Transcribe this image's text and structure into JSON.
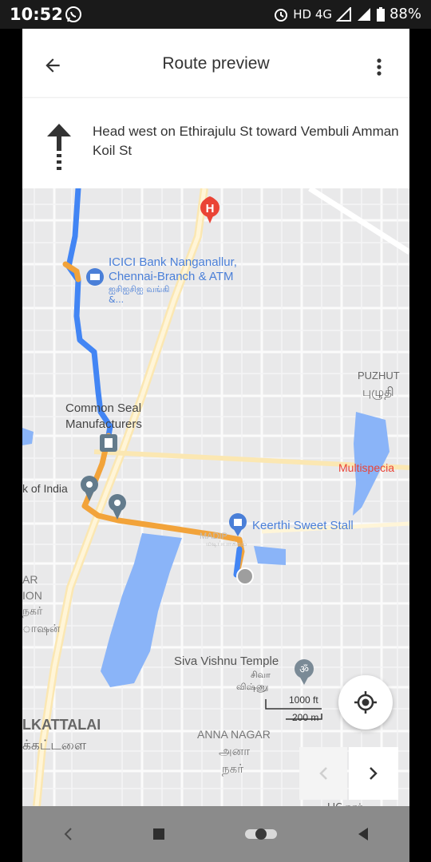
{
  "status_bar": {
    "time": "10:52",
    "network": "HD 4G",
    "battery": "88%"
  },
  "header": {
    "title": "Route preview"
  },
  "direction": {
    "text": "Head west on Ethirajulu St toward Vembuli Amman Koil St"
  },
  "map": {
    "labels": {
      "icici": "ICICI Bank Nanganallur, Chennai-Branch & ATM",
      "icici_tamil": "ஐசிஐசிஐ வங்கி &...",
      "common_seal": "Common Seal Manufacturers",
      "bank_of_india": "k of India",
      "puzhu": "PUZHUT",
      "puzhu_tamil": "புழுதி",
      "multispecial": "Multispecia",
      "keerthi": "Keerthi Sweet Stall",
      "madipakkam": "MADIP",
      "madipakkam_tamil": "மடிப்பாக்கம்",
      "ar": "AR",
      "ion": "ION",
      "nagar_tamil": "நகர்",
      "station_tamil": "ாஷன்",
      "siva_vishnu": "Siva Vishnu Temple",
      "siva_tamil": "சிவா",
      "vishnu_tamil": "விஷ்ணு",
      "kattalai": "LKATTALAI",
      "kattalai_tamil": "க்கட்டளை",
      "anna_nagar": "ANNA NAGAR",
      "anna_tamil": "அனா",
      "anna_tamil2": "நகர்",
      "scale_ft": "1000 ft",
      "scale_m": "200 m",
      "lic": "LIC நகர்"
    },
    "colors": {
      "background": "#e9e9ea",
      "route_blue": "#4285f4",
      "route_orange": "#f2a33a",
      "water": "#8ab4f8",
      "hospital": "#ea4335",
      "poi_blue": "#4a7fd8",
      "poi_gray": "#637b8c",
      "temple": "#7a8a96"
    }
  }
}
